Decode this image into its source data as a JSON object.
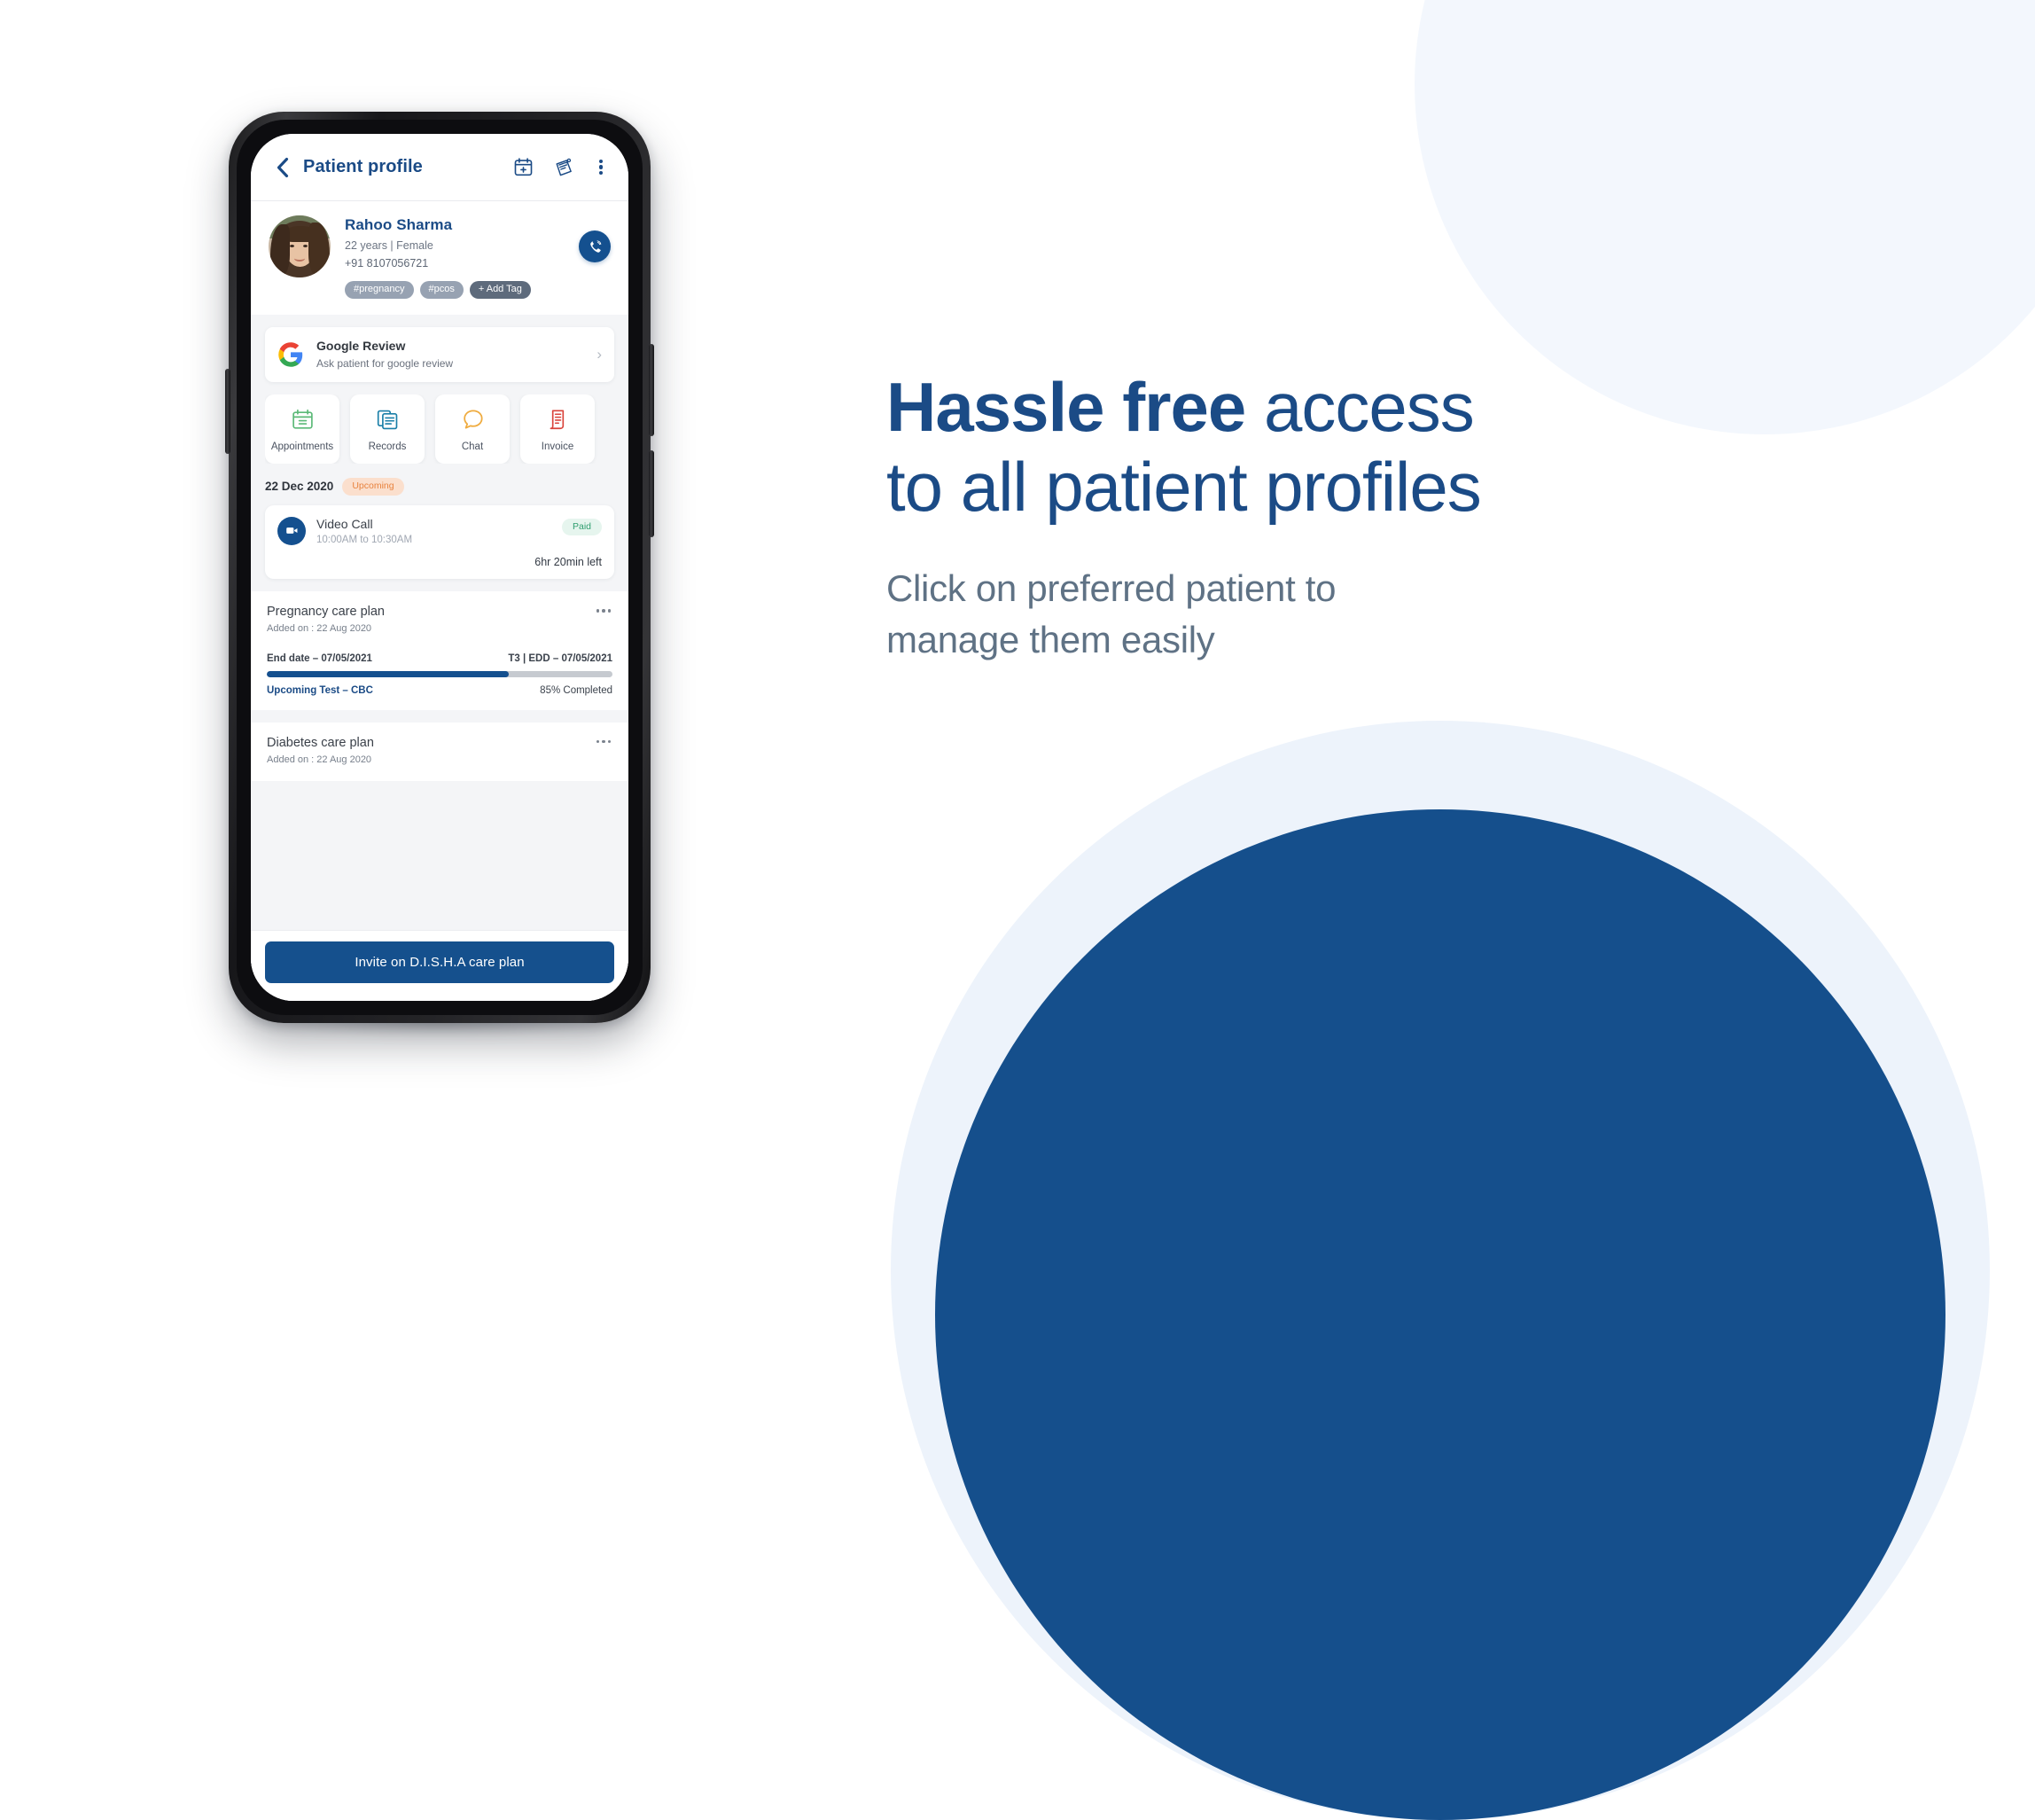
{
  "theme": {
    "brand_navy": "#15508d",
    "headline_blue": "#1b4b86",
    "subhead_slate": "#5f7285",
    "screen_bg": "#f4f5f7",
    "status_orange": "#e8833f",
    "status_green": "#2f9e6f"
  },
  "app": {
    "header": {
      "back_icon": "chevron-left-icon",
      "title": "Patient profile",
      "actions": [
        {
          "icon": "calendar-add-icon",
          "name": "add-appointment-button"
        },
        {
          "icon": "prescription-pad-icon",
          "name": "prescription-button"
        },
        {
          "icon": "more-vertical-icon",
          "name": "more-menu-button"
        }
      ]
    },
    "patient": {
      "name": "Rahoo Sharma",
      "demographics": "22 years | Female",
      "phone": "+91 8107056721",
      "avatar_alt": "patient-photo",
      "call_icon": "phone-call-icon",
      "tags": [
        {
          "label": "#pregnancy",
          "style": "default"
        },
        {
          "label": "#pcos",
          "style": "default"
        },
        {
          "label": "+ Add Tag",
          "style": "add"
        }
      ]
    },
    "google_review": {
      "icon": "google-logo-icon",
      "title": "Google Review",
      "subtitle": "Ask patient for google review",
      "chevron": "chevron-right-icon"
    },
    "quick_actions": [
      {
        "label": "Appointments",
        "icon": "calendar-icon",
        "color": "#5bb977"
      },
      {
        "label": "Records",
        "icon": "documents-icon",
        "color": "#1a7fa8"
      },
      {
        "label": "Chat",
        "icon": "chat-bubble-icon",
        "color": "#efab3e"
      },
      {
        "label": "Invoice",
        "icon": "invoice-icon",
        "color": "#d9443c"
      }
    ],
    "appointment": {
      "date": "22 Dec 2020",
      "status_badge": "Upcoming",
      "type": "Video Call",
      "type_icon": "video-camera-icon",
      "time": "10:00AM to 10:30AM",
      "payment_badge": "Paid",
      "countdown": "6hr 20min left"
    },
    "care_plans": [
      {
        "title": "Pregnancy care plan",
        "added_on": "Added on : 22 Aug 2020",
        "end_date": "End date –  07/05/2021",
        "edd": "T3 | EDD – 07/05/2021",
        "upcoming_test": "Upcoming Test – CBC",
        "completion": "85% Completed",
        "progress_percent": 70
      },
      {
        "title": "Diabetes care plan",
        "added_on": "Added on : 22 Aug 2020"
      }
    ],
    "footer": {
      "invite_button": "Invite on D.I.S.H.A care plan"
    }
  },
  "marketing": {
    "headline_emphasis": "Hassle free",
    "headline_rest": " access",
    "headline_line2": "to all patient profiles",
    "subheadline_line1": "Click on preferred patient to",
    "subheadline_line2": "manage them easily"
  }
}
